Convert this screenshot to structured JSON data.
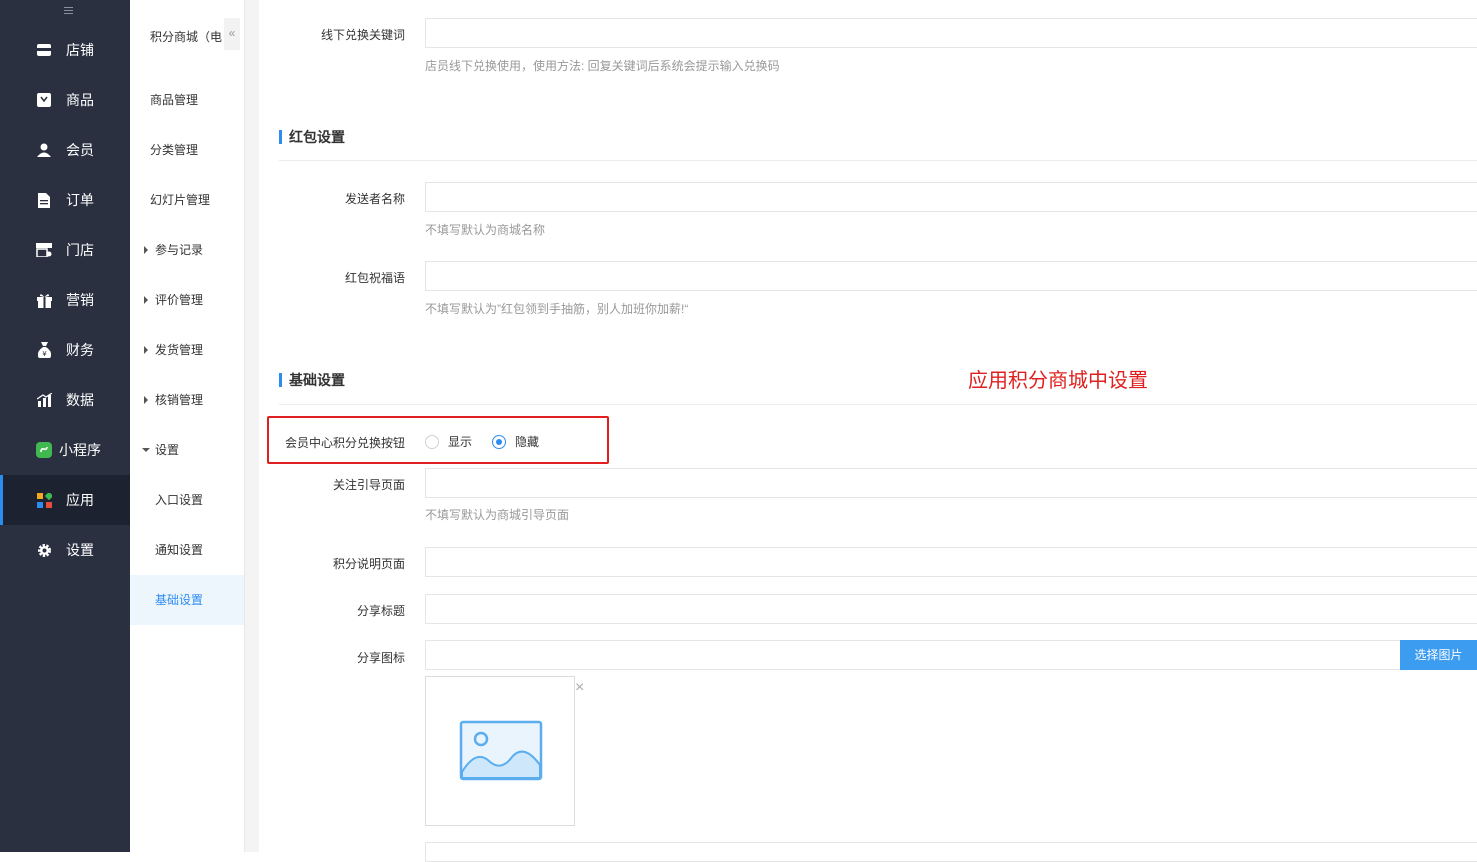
{
  "nav": {
    "items": [
      {
        "label": "店铺",
        "icon": "store-icon"
      },
      {
        "label": "商品",
        "icon": "goods-icon"
      },
      {
        "label": "会员",
        "icon": "member-icon"
      },
      {
        "label": "订单",
        "icon": "order-icon"
      },
      {
        "label": "门店",
        "icon": "shop-icon"
      },
      {
        "label": "营销",
        "icon": "gift-icon"
      },
      {
        "label": "财务",
        "icon": "finance-icon"
      },
      {
        "label": "数据",
        "icon": "data-icon"
      },
      {
        "label": "小程序",
        "icon": "miniprogram-icon"
      },
      {
        "label": "应用",
        "icon": "apps-icon",
        "active": true
      },
      {
        "label": "设置",
        "icon": "gear-icon"
      }
    ]
  },
  "subnav": {
    "title": "积分商城（电",
    "items": [
      {
        "label": "商品管理"
      },
      {
        "label": "分类管理"
      },
      {
        "label": "幻灯片管理"
      },
      {
        "label": "参与记录"
      },
      {
        "label": "评价管理"
      },
      {
        "label": "发货管理"
      },
      {
        "label": "核销管理"
      },
      {
        "label": "设置"
      },
      {
        "label": "入口设置"
      },
      {
        "label": "通知设置"
      },
      {
        "label": "基础设置",
        "active": true
      }
    ]
  },
  "form": {
    "offline_keyword": {
      "label": "线下兑换关键词",
      "help": "店员线下兑换使用，使用方法: 回复关键词后系统会提示输入兑换码"
    },
    "redpacket_section": "红包设置",
    "sender_name": {
      "label": "发送者名称",
      "help": "不填写默认为商城名称"
    },
    "wish": {
      "label": "红包祝福语",
      "help": "不填写默认为”红包领到手抽筋，别人加班你加薪!“"
    },
    "basic_section": "基础设置",
    "exchange_button": {
      "label": "会员中心积分兑换按钮",
      "options": [
        "显示",
        "隐藏"
      ],
      "selected": "隐藏"
    },
    "follow_page": {
      "label": "关注引导页面",
      "help": "不填写默认为商城引导页面"
    },
    "points_page": {
      "label": "积分说明页面"
    },
    "share_title": {
      "label": "分享标题"
    },
    "share_icon": {
      "label": "分享图标",
      "button": "选择图片"
    }
  },
  "annotation": {
    "text": "应用积分商城中设置",
    "color": "#e02020"
  },
  "colors": {
    "nav_bg": "#2a3040",
    "accent": "#2d8cf0",
    "annotation": "#e02020"
  }
}
